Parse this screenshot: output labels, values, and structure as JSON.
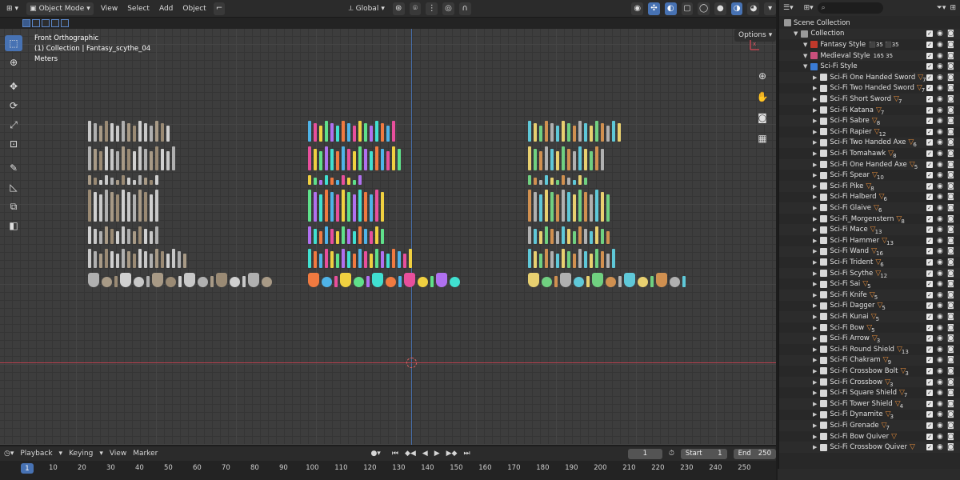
{
  "header": {
    "mode_label": "Object Mode",
    "menus": [
      "View",
      "Select",
      "Add",
      "Object"
    ],
    "transform_orientation": "Global"
  },
  "viewport": {
    "view_name": "Front Orthographic",
    "collection_info": "(1) Collection | Fantasy_scythe_04",
    "units": "Meters",
    "options_label": "Options"
  },
  "outliner": {
    "search_placeholder": "",
    "items": [
      {
        "label": "Scene Collection",
        "level": 0,
        "type": "scene"
      },
      {
        "label": "Collection",
        "level": 1,
        "type": "collection"
      },
      {
        "label": "Fantasy Style",
        "level": 2,
        "type": "collection-red",
        "badge": "⬛35 ⬛35"
      },
      {
        "label": "Medieval Style",
        "level": 2,
        "type": "collection-pink",
        "badge": "165 35"
      },
      {
        "label": "Sci-Fi Style",
        "level": 2,
        "type": "collection-blue",
        "badge": ""
      },
      {
        "label": "Sci-Fi One Handed Sword",
        "level": 3,
        "type": "object",
        "count": "7"
      },
      {
        "label": "Sci-Fi Two Handed Sword",
        "level": 3,
        "type": "object",
        "count": "7"
      },
      {
        "label": "Sci-Fi Short Sword",
        "level": 3,
        "type": "object",
        "count": "7"
      },
      {
        "label": "Sci-Fi Katana",
        "level": 3,
        "type": "object",
        "count": "7"
      },
      {
        "label": "Sci-Fi Sabre",
        "level": 3,
        "type": "object",
        "count": "8"
      },
      {
        "label": "Sci-Fi Rapier",
        "level": 3,
        "type": "object",
        "count": "12"
      },
      {
        "label": "Sci-Fi Two Handed Axe",
        "level": 3,
        "type": "object",
        "count": "6"
      },
      {
        "label": "Sci-Fi Tomahawk",
        "level": 3,
        "type": "object",
        "count": "8"
      },
      {
        "label": "Sci-Fi One Handed Axe",
        "level": 3,
        "type": "object",
        "count": "5"
      },
      {
        "label": "Sci-Fi Spear",
        "level": 3,
        "type": "object",
        "count": "10"
      },
      {
        "label": "Sci-Fi Pike",
        "level": 3,
        "type": "object",
        "count": "8"
      },
      {
        "label": "Sci-Fi Halberd",
        "level": 3,
        "type": "object",
        "count": "6"
      },
      {
        "label": "Sci-Fi Glaive",
        "level": 3,
        "type": "object",
        "count": "6"
      },
      {
        "label": "Sci-Fi_Morgenstern",
        "level": 3,
        "type": "object",
        "count": "8"
      },
      {
        "label": "Sci-Fi Mace",
        "level": 3,
        "type": "object",
        "count": "13"
      },
      {
        "label": "Sci-Fi Hammer",
        "level": 3,
        "type": "object",
        "count": "13"
      },
      {
        "label": "Sci-Fi Wand",
        "level": 3,
        "type": "object",
        "count": "16"
      },
      {
        "label": "Sci-Fi Trident",
        "level": 3,
        "type": "object",
        "count": "6"
      },
      {
        "label": "Sci-Fi Scythe",
        "level": 3,
        "type": "object",
        "count": "12"
      },
      {
        "label": "Sci-Fi Sai",
        "level": 3,
        "type": "object",
        "count": "5"
      },
      {
        "label": "Sci-Fi Knife",
        "level": 3,
        "type": "object",
        "count": "5"
      },
      {
        "label": "Sci-Fi Dagger",
        "level": 3,
        "type": "object",
        "count": "5"
      },
      {
        "label": "Sci-Fi Kunai",
        "level": 3,
        "type": "object",
        "count": "5"
      },
      {
        "label": "Sci-Fi Bow",
        "level": 3,
        "type": "object",
        "count": "5"
      },
      {
        "label": "Sci-Fi Arrow",
        "level": 3,
        "type": "object",
        "count": "3"
      },
      {
        "label": "Sci-Fi Round Shield",
        "level": 3,
        "type": "object",
        "count": "13"
      },
      {
        "label": "Sci-Fi Chakram",
        "level": 3,
        "type": "object",
        "count": "9"
      },
      {
        "label": "Sci-Fi Crossbow Bolt",
        "level": 3,
        "type": "object",
        "count": "3"
      },
      {
        "label": "Sci-Fi Crossbow",
        "level": 3,
        "type": "object",
        "count": "3"
      },
      {
        "label": "Sci-Fi Square Shield",
        "level": 3,
        "type": "object",
        "count": "7"
      },
      {
        "label": "Sci-Fi Tower Shield",
        "level": 3,
        "type": "object",
        "count": "4"
      },
      {
        "label": "Sci-Fi Dynamite",
        "level": 3,
        "type": "object",
        "count": "3"
      },
      {
        "label": "Sci-Fi Grenade",
        "level": 3,
        "type": "object",
        "count": "7"
      },
      {
        "label": "Sci-Fi Bow Quiver",
        "level": 3,
        "type": "object",
        "count": ""
      },
      {
        "label": "Sci-Fi Crossbow Quiver",
        "level": 3,
        "type": "object",
        "count": ""
      }
    ]
  },
  "timeline": {
    "menus": [
      "Playback",
      "Keying",
      "View",
      "Marker"
    ],
    "current_frame": "1",
    "start_label": "Start",
    "start_value": "1",
    "end_label": "End",
    "end_value": "250",
    "ruler_ticks": [
      "1",
      "10",
      "20",
      "30",
      "40",
      "50",
      "60",
      "70",
      "80",
      "90",
      "100",
      "110",
      "120",
      "130",
      "140",
      "150",
      "160",
      "170",
      "180",
      "190",
      "200",
      "210",
      "220",
      "230",
      "240",
      "250"
    ]
  },
  "colors": {
    "accent": "#4772b3",
    "x_axis": "#b8404e",
    "z_axis": "#4a7bc4",
    "triangle_badge": "#e08a3a"
  }
}
